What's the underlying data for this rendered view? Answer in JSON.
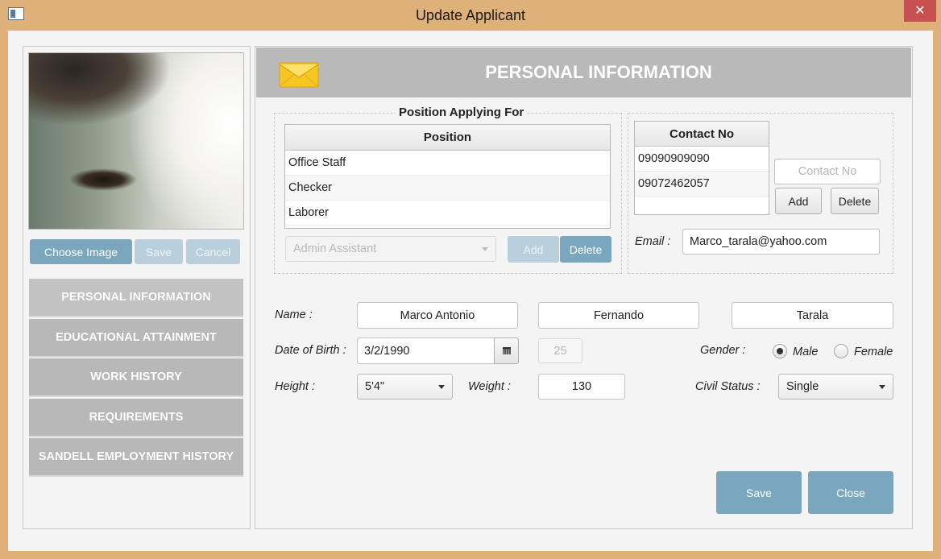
{
  "window": {
    "title": "Update Applicant",
    "close_glyph": "✕",
    "icon": "window-app-icon"
  },
  "photo": {
    "choose_label": "Choose Image",
    "save_label": "Save",
    "cancel_label": "Cancel"
  },
  "nav": {
    "items": [
      {
        "label": "PERSONAL INFORMATION"
      },
      {
        "label": "EDUCATIONAL ATTAINMENT"
      },
      {
        "label": "WORK HISTORY"
      },
      {
        "label": "REQUIREMENTS"
      },
      {
        "label": "SANDELL EMPLOYMENT HISTORY"
      }
    ]
  },
  "header": {
    "title": "PERSONAL INFORMATION",
    "icon": "envelope-icon"
  },
  "positions": {
    "legend": "Position Applying For",
    "column": "Position",
    "rows": [
      "Office Staff",
      "Checker",
      "Laborer"
    ],
    "combo_value": "Admin Assistant",
    "add_label": "Add",
    "delete_label": "Delete"
  },
  "contacts": {
    "column": "Contact No",
    "rows": [
      "09090909090",
      "09072462057"
    ],
    "input_placeholder": "Contact No",
    "add_label": "Add",
    "delete_label": "Delete"
  },
  "email": {
    "label": "Email :",
    "value": "Marco_tarala@yahoo.com"
  },
  "name": {
    "label": "Name :",
    "first": "Marco Antonio",
    "middle": "Fernando",
    "last": "Tarala"
  },
  "birth": {
    "label": "Date of Birth :",
    "value": "3/2/1990",
    "age": "25"
  },
  "gender": {
    "label": "Gender :",
    "male": "Male",
    "female": "Female",
    "selected": "Male"
  },
  "height": {
    "label": "Height :",
    "value": "5'4\""
  },
  "weight": {
    "label": "Weight :",
    "value": "130"
  },
  "civil": {
    "label": "Civil Status :",
    "value": "Single"
  },
  "actions": {
    "save_label": "Save",
    "close_label": "Close"
  },
  "colors": {
    "accent": "#7aa7bd",
    "header": "#b9b9b9",
    "frame": "#deb07a",
    "close": "#c75050"
  }
}
